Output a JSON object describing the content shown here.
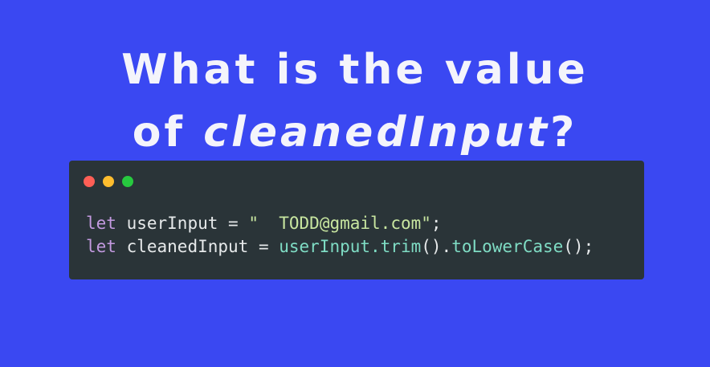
{
  "headline": {
    "line1": "What is the value",
    "line2_prefix": "of ",
    "line2_emphasis": "cleanedInput",
    "line2_suffix": "?"
  },
  "code_window": {
    "dot_colors": [
      "#ff5f56",
      "#ffbd2e",
      "#27c93f"
    ],
    "line1": {
      "keyword": "let",
      "identifier": " userInput = ",
      "string": "\"  TODD@gmail.com\"",
      "end": ";"
    },
    "line2": {
      "keyword": "let",
      "identifier": " cleanedInput = ",
      "receiver": "userInput.trim",
      "paren1": "()",
      "dot": ".",
      "method": "toLowerCase",
      "end": "();"
    }
  },
  "colors": {
    "background": "#3a48f2",
    "code_bg": "#2a3438",
    "keyword": "#c39ae0",
    "string": "#c8e6a0",
    "function": "#7fdcc4"
  }
}
